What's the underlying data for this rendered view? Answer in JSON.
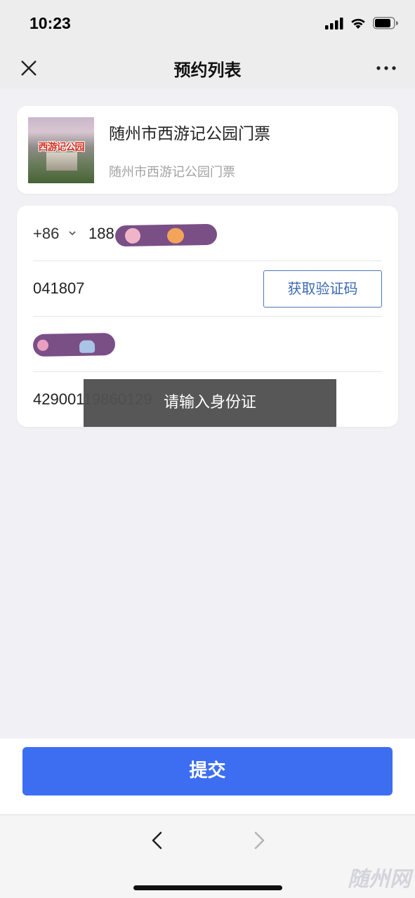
{
  "status_bar": {
    "time": "10:23",
    "icons": [
      "signal-icon",
      "wifi-icon",
      "battery-icon"
    ]
  },
  "nav": {
    "title": "预约列表",
    "close_icon": "close-icon",
    "more_icon": "more-icon"
  },
  "product": {
    "title": "随州市西游记公园门票",
    "subtitle": "随州市西游记公园门票",
    "thumbnail_logo_text": "西游记公园"
  },
  "form": {
    "country_code": "+86",
    "phone_value": "188",
    "verification_code": "041807",
    "get_code_button": "获取验证码",
    "id_number": "42900119860129"
  },
  "toast": {
    "message": "请输入身份证"
  },
  "actions": {
    "submit_label": "提交"
  },
  "watermark": "随州网",
  "colors": {
    "primary": "#3d6ef2",
    "code_button_border": "#4d78b8",
    "toast_bg": "#505050",
    "scribble": "#7a4f86",
    "page_bg": "#f1f1f5"
  }
}
